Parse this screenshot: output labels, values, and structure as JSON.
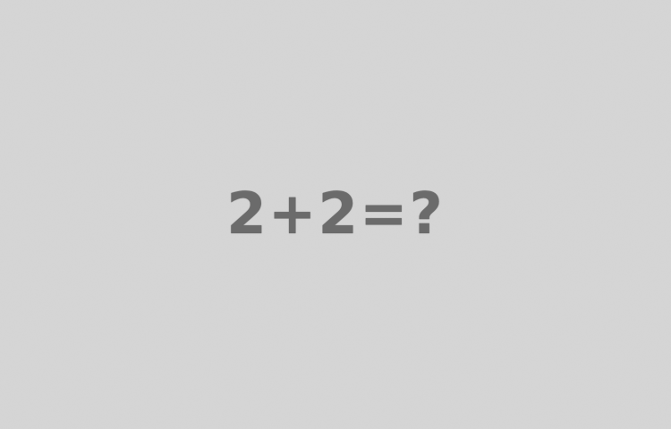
{
  "background_color": "#d6d6d6",
  "text_color": "#6b6b6b",
  "equation": {
    "text": "2+2=?"
  }
}
